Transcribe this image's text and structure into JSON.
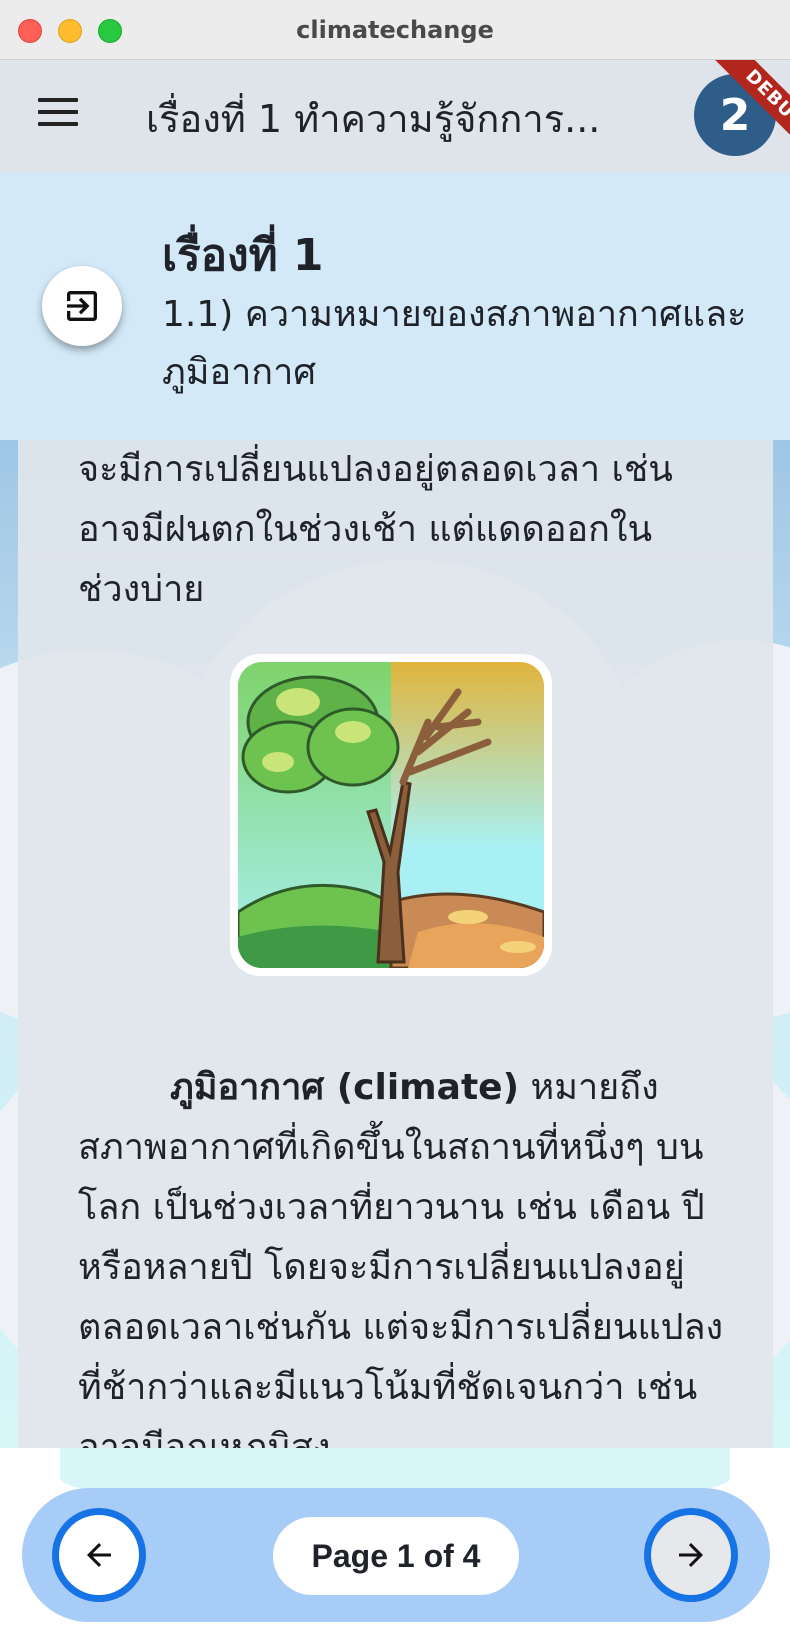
{
  "window": {
    "title": "climatechange"
  },
  "appbar": {
    "title": "เรื่องที่ 1 ทำความรู้จักการ...",
    "avatar_letter": "2",
    "debug_label": "DEBUG"
  },
  "lesson": {
    "title": "เรื่องที่ 1",
    "subtitle": "1.1) ความหมายของสภาพอากาศและภูมิอากาศ"
  },
  "content": {
    "paragraph1": "จะมีการเปลี่ยนแปลงอยู่ตลอดเวลา เช่น อาจมีฝนตกในช่วงเช้า แต่แดดออกในช่วงบ่าย",
    "paragraph2_term": "ภูมิอากาศ (climate)",
    "paragraph2_body": " หมายถึงสภาพอากาศที่เกิดขึ้นในสถานที่หนึ่งๆ บนโลก เป็นช่วงเวลาที่ยาวนาน เช่น เดือน ปี หรือหลายปี โดยจะมีการเปลี่ยนแปลงอยู่ตลอดเวลาเช่นกัน แต่จะมีการเปลี่ยนแปลงที่ช้ากว่าและมีแนวโน้มที่ชัดเจนกว่า เช่น อาจมีอุณหภูมิสูง"
  },
  "pagination": {
    "label": "Page 1 of 4"
  },
  "icons": {
    "menu": "menu-icon",
    "exit": "exit-icon",
    "prev": "arrow-left-icon",
    "next": "arrow-right-icon"
  },
  "colors": {
    "appbar": "#dfe3ea",
    "lesson_header": "#d3e9f8",
    "nav_bar": "#a8ccf8",
    "nav_button_border": "#1673e6",
    "debug_ribbon": "#b3261e"
  }
}
